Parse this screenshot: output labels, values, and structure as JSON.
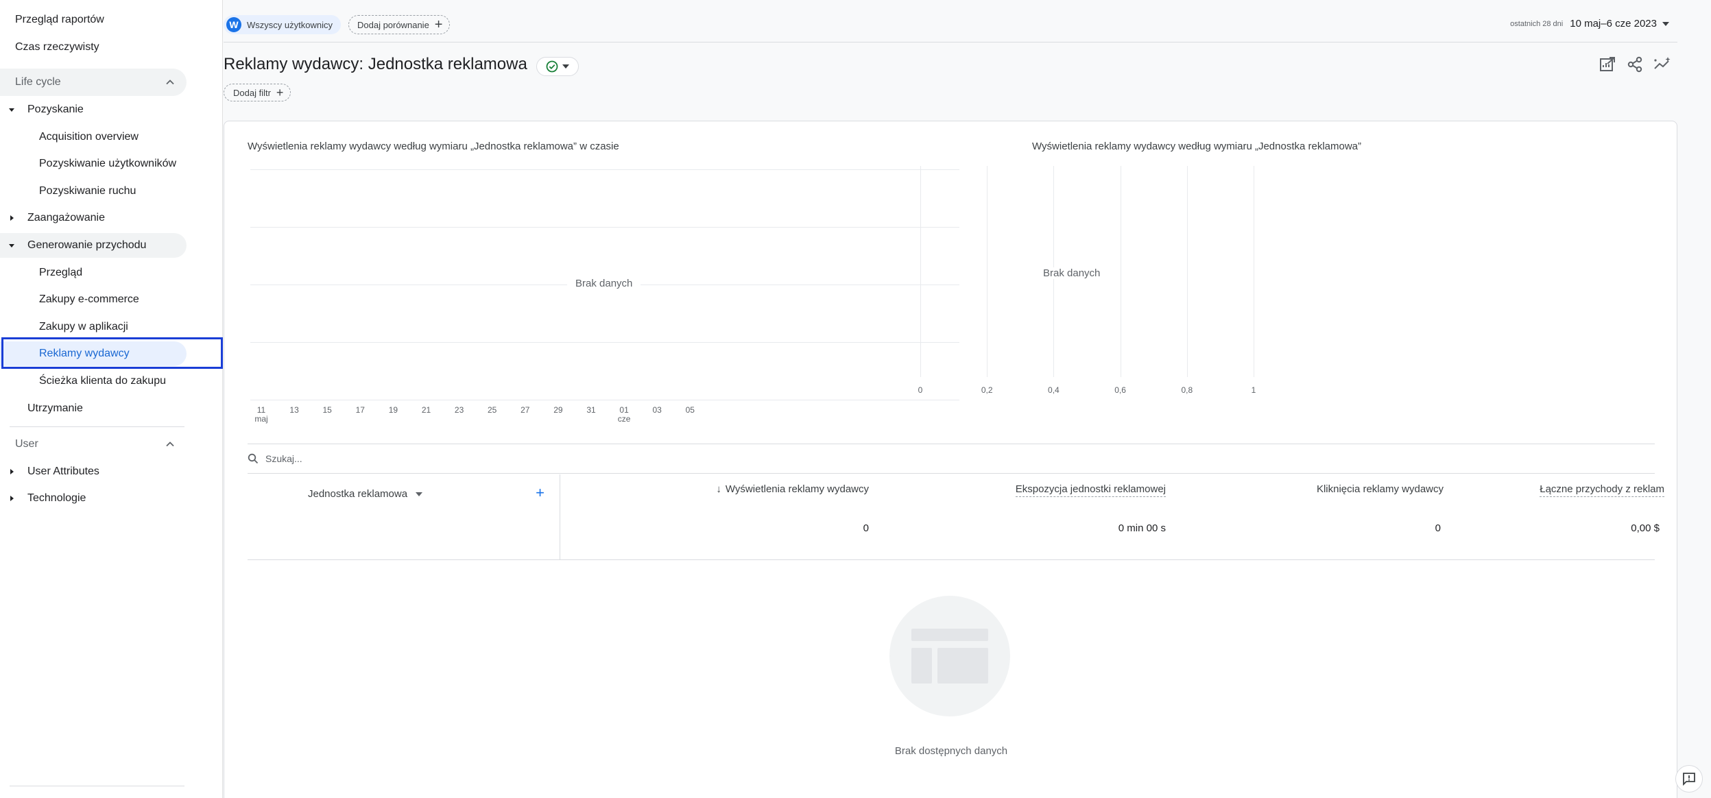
{
  "sidebar": {
    "top_items": [
      {
        "label": "Przegląd raportów"
      },
      {
        "label": "Czas rzeczywisty"
      }
    ],
    "section_lifecycle": "Life cycle",
    "lifecycle": {
      "acquisition": {
        "label": "Pozyskanie",
        "children": [
          "Acquisition overview",
          "Pozyskiwanie użytkowników",
          "Pozyskiwanie ruchu"
        ]
      },
      "engagement": {
        "label": "Zaangażowanie"
      },
      "monetization": {
        "label": "Generowanie przychodu",
        "children": [
          "Przegląd",
          "Zakupy e-commerce",
          "Zakupy w aplikacji",
          "Reklamy wydawcy",
          "Ścieżka klienta do zakupu"
        ]
      },
      "retention": {
        "label": "Utrzymanie"
      }
    },
    "section_user": "User",
    "user": {
      "attributes": {
        "label": "User Attributes"
      },
      "technology": {
        "label": "Technologie"
      }
    },
    "active_item": "Reklamy wydawcy"
  },
  "topbar": {
    "segment_avatar": "W",
    "segment_label": "Wszyscy użytkownicy",
    "compare_label": "Dodaj porównanie",
    "date_prefix": "ostatnich 28 dni",
    "date_range": "10 maj–6 cze 2023"
  },
  "header": {
    "title": "Reklamy wydawcy: Jednostka reklamowa",
    "add_filter_label": "Dodaj filtr"
  },
  "line_chart": {
    "title": "Wyświetlenia reklamy wydawcy według wymiaru „Jednostka reklamowa” w czasie",
    "no_data": "Brak danych",
    "x_ticks": [
      {
        "label": "11",
        "sub": "maj"
      },
      {
        "label": "13",
        "sub": ""
      },
      {
        "label": "15",
        "sub": ""
      },
      {
        "label": "17",
        "sub": ""
      },
      {
        "label": "19",
        "sub": ""
      },
      {
        "label": "21",
        "sub": ""
      },
      {
        "label": "23",
        "sub": ""
      },
      {
        "label": "25",
        "sub": ""
      },
      {
        "label": "27",
        "sub": ""
      },
      {
        "label": "29",
        "sub": ""
      },
      {
        "label": "31",
        "sub": ""
      },
      {
        "label": "01",
        "sub": "cze"
      },
      {
        "label": "03",
        "sub": ""
      },
      {
        "label": "05",
        "sub": ""
      }
    ]
  },
  "bar_chart": {
    "title": "Wyświetlenia reklamy wydawcy według wymiaru „Jednostka reklamowa”",
    "no_data": "Brak danych",
    "x_ticks": [
      "0",
      "0,2",
      "0,4",
      "0,6",
      "0,8",
      "1"
    ]
  },
  "chart_data": [
    {
      "type": "line",
      "title": "Wyświetlenia reklamy wydawcy według wymiaru „Jednostka reklamowa” w czasie",
      "x": [
        "11 maj",
        "13",
        "15",
        "17",
        "19",
        "21",
        "23",
        "25",
        "27",
        "29",
        "31",
        "01 cze",
        "03",
        "05"
      ],
      "series": [],
      "annotation": "Brak danych"
    },
    {
      "type": "bar",
      "title": "Wyświetlenia reklamy wydawcy według wymiaru „Jednostka reklamowa”",
      "xlim": [
        0,
        1
      ],
      "x_ticks": [
        0,
        0.2,
        0.4,
        0.6,
        0.8,
        1
      ],
      "categories": [],
      "values": [],
      "annotation": "Brak danych"
    }
  ],
  "table": {
    "search_placeholder": "Szukaj...",
    "dimension_header": "Jednostka reklamowa",
    "sort_indicator": "↓",
    "columns": [
      {
        "label": "Wyświetlenia reklamy wydawcy",
        "total": "0"
      },
      {
        "label": "Ekspozycja jednostki reklamowej",
        "total": "0 min 00 s"
      },
      {
        "label": "Kliknięcia reklamy wydawcy",
        "total": "0"
      },
      {
        "label": "Łączne przychody z reklam",
        "total": "0,00 $"
      }
    ],
    "empty_message": "Brak dostępnych danych"
  },
  "colors": {
    "accent": "#1a73e8",
    "active_bg": "#e8f0fe",
    "annotation": "#1a3ed6",
    "status_ok": "#188038"
  }
}
